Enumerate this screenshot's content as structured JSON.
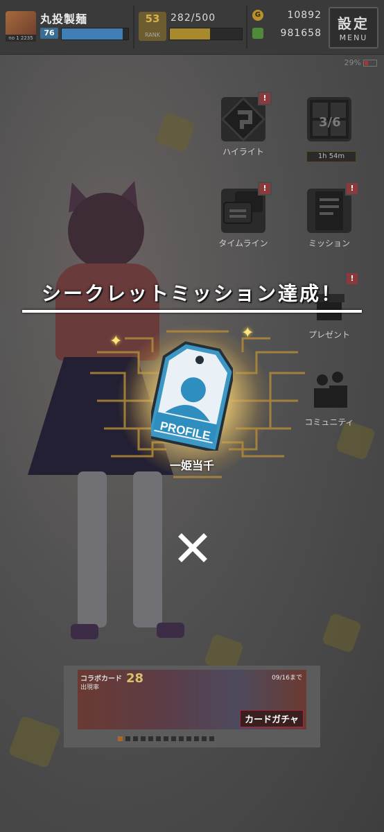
{
  "header": {
    "username": "丸投製麺",
    "level": "76",
    "level_progress": 0.92,
    "avatar_tag": "no 1 2235",
    "rank_number": "53",
    "rank_label": "RANK",
    "stamina": "282/500",
    "stamina_progress": 0.56,
    "coins": "10892",
    "gems": "981658",
    "menu_kanji": "設定",
    "menu_label": "MENU",
    "battery": "29%"
  },
  "side_menu": {
    "highlight_label": "ハイライト",
    "timeline_label": "タイムライン",
    "mission_label": "ミッション",
    "present_label": "プレゼント",
    "community_label": "コミュニティ",
    "page_fraction": "3/6",
    "timer": "1h 54m",
    "notice_mark": "!"
  },
  "banner": {
    "line1": "コラボカード",
    "line2": "出現率",
    "number": "28",
    "date": "09/16まで",
    "gacha_label": "カードガチャ",
    "dot_count": 13,
    "active_dot": 0
  },
  "dialog": {
    "title": "シークレットミッション達成！",
    "reward_label": "PROFILE",
    "reward_name": "一姫当千",
    "close_symbol": "✕"
  },
  "colors": {
    "accent_gold": "#d4b24a",
    "tag_blue": "#3d97c4",
    "notice_red": "#8a3a3a"
  }
}
